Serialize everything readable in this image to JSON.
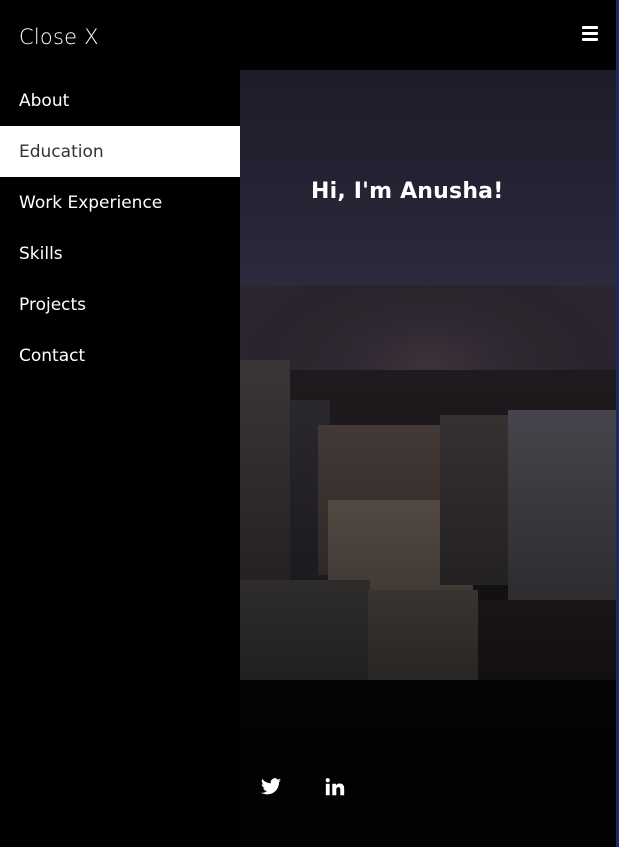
{
  "topbar": {
    "close_label": "Close X",
    "menu_icon": "hamburger-icon"
  },
  "sidebar": {
    "items": [
      {
        "label": "About",
        "active": false
      },
      {
        "label": "Education",
        "active": true
      },
      {
        "label": "Work Experience",
        "active": false
      },
      {
        "label": "Skills",
        "active": false
      },
      {
        "label": "Projects",
        "active": false
      },
      {
        "label": "Contact",
        "active": false
      }
    ]
  },
  "hero": {
    "greeting": "Hi, I'm Anusha!",
    "background": "night-city-skyline-photo"
  },
  "social": {
    "icons": [
      "twitter-icon",
      "linkedin-icon"
    ]
  },
  "colors": {
    "background": "#000000",
    "text": "#ffffff",
    "active_bg": "#ffffff",
    "active_text": "#333333"
  }
}
